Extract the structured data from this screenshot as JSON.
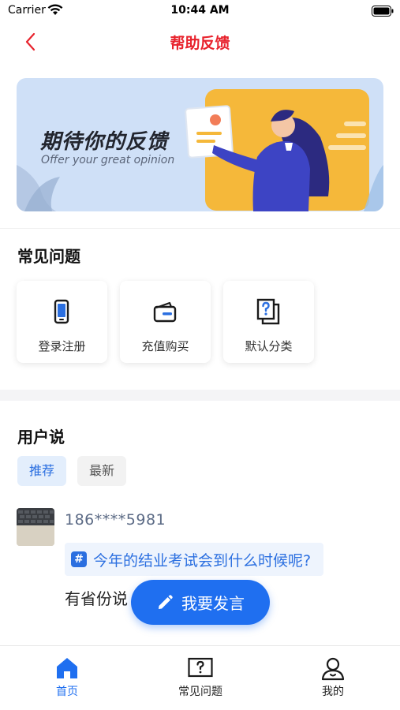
{
  "status_bar": {
    "carrier": "Carrier",
    "time": "10:44 AM"
  },
  "nav": {
    "title": "帮助反馈"
  },
  "banner": {
    "title": "期待你的反馈",
    "subtitle": "Offer your great opinion"
  },
  "faq": {
    "title": "常见问题",
    "items": [
      {
        "label": "登录注册",
        "icon": "phone-icon"
      },
      {
        "label": "充值购买",
        "icon": "wallet-icon"
      },
      {
        "label": "默认分类",
        "icon": "question-docs-icon"
      }
    ]
  },
  "user_says": {
    "title": "用户说",
    "tabs": [
      {
        "label": "推荐",
        "active": true
      },
      {
        "label": "最新",
        "active": false
      }
    ],
    "post": {
      "username": "186****5981",
      "topic": "今年的结业考试会到什么时候呢?",
      "text": "有省份说                         是还没有官方通知"
    }
  },
  "fab": {
    "label": "我要发言"
  },
  "tabbar": {
    "items": [
      {
        "label": "首页",
        "active": true
      },
      {
        "label": "常见问题",
        "active": false
      },
      {
        "label": "我的",
        "active": false
      }
    ]
  },
  "colors": {
    "accent": "#1f6ff0",
    "title_red": "#e8232d",
    "tab_active": "#2b6fe0"
  }
}
